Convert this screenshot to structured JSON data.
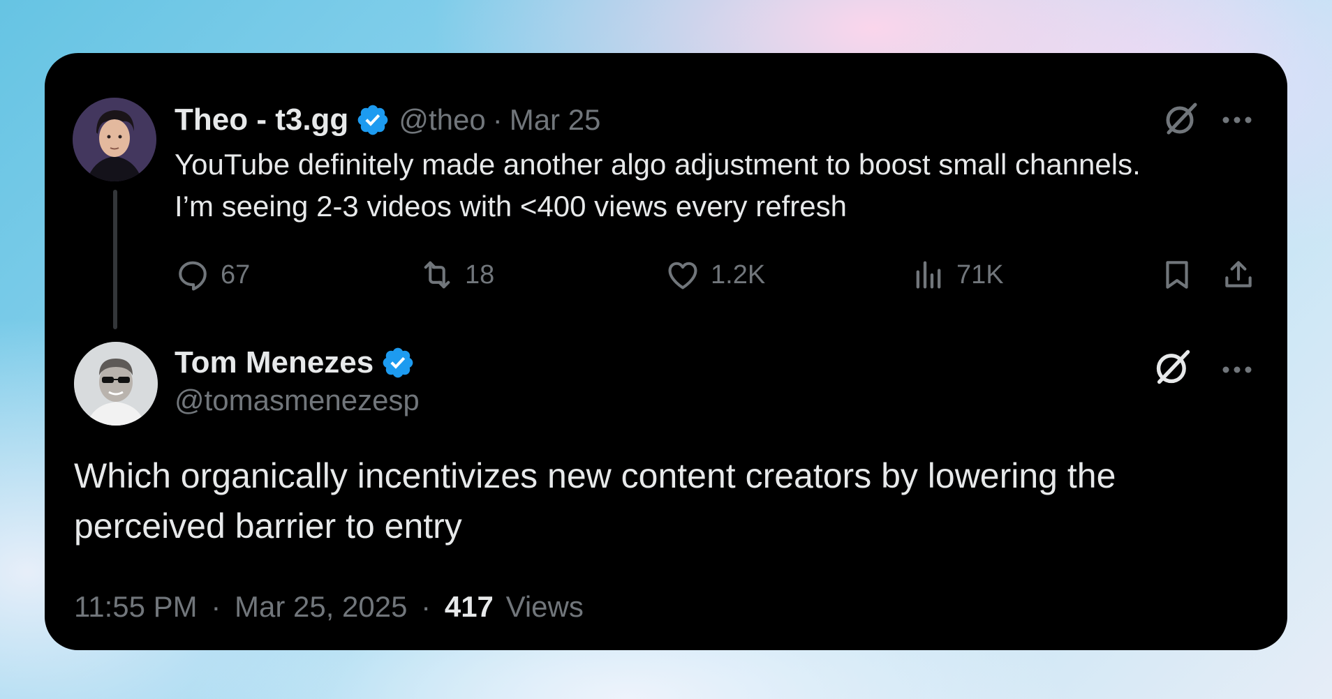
{
  "original_tweet": {
    "author_name": "Theo - t3.gg",
    "handle": "@theo",
    "separator": "·",
    "date": "Mar 25",
    "text_line1": "YouTube definitely made another algo adjustment to boost small channels.",
    "text_line2": "I’m seeing 2-3 videos with <400 views every refresh",
    "actions": {
      "replies": "67",
      "reposts": "18",
      "likes": "1.2K",
      "views": "71K"
    }
  },
  "reply_tweet": {
    "author_name": "Tom Menezes",
    "handle": "@tomasmenezesp",
    "text": "Which organically incentivizes new content creators by lowering the perceived barrier to entry",
    "time": "11:55 PM",
    "separator": "·",
    "date": "Mar 25, 2025",
    "views_count": "417",
    "views_label": "Views"
  },
  "icons": {
    "verified": "verified-badge-icon",
    "grok": "grok-icon",
    "more": "more-icon",
    "reply": "reply-icon",
    "repost": "repost-icon",
    "like": "heart-icon",
    "analytics": "analytics-icon",
    "bookmark": "bookmark-icon",
    "share": "share-icon"
  },
  "colors": {
    "card_background": "#000000",
    "primary_text": "#e7e9ea",
    "secondary_text": "#71767b",
    "verified_blue": "#1d9bf0",
    "thread_line": "#333639"
  }
}
